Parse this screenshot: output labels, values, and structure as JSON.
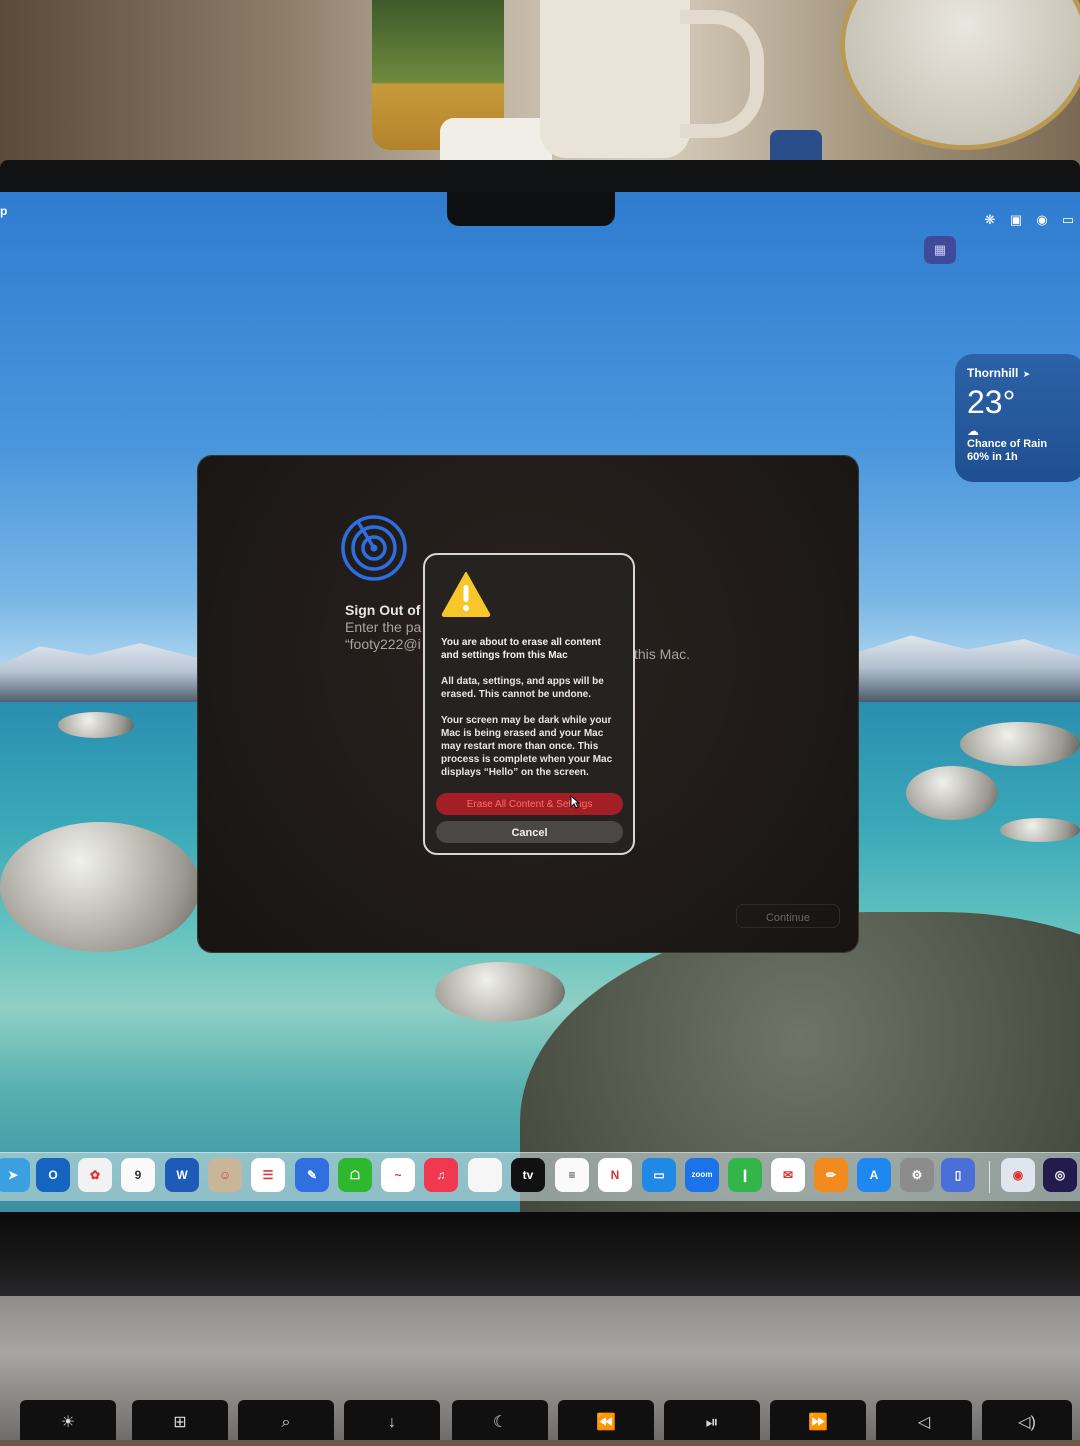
{
  "menubar": {
    "left_fragment": "p",
    "icons": [
      "chatgpt-icon",
      "screen-share-icon",
      "record-icon",
      "battery-icon"
    ]
  },
  "weather": {
    "city": "Thornhill",
    "location_glyph": "➤",
    "temperature": "23°",
    "condition_line1": "Chance of Rain",
    "condition_line2": "60% in 1h"
  },
  "assistant": {
    "title": "Sign Out of",
    "line1": "Enter the pa",
    "line2": "“footy222@i",
    "right_fragment": "this Mac.",
    "continue_label": "Continue"
  },
  "alert": {
    "title": "You are about to erase all content and settings from this Mac",
    "paragraph1": "All data, settings, and apps will be erased. This cannot be undone.",
    "paragraph2": "Your screen may be dark while your Mac is being erased and your Mac may restart more than once. This process is complete when your Mac displays “Hello” on the screen.",
    "erase_label": "Erase All Content & Settings",
    "cancel_label": "Cancel"
  },
  "dock": {
    "items": [
      {
        "name": "maps",
        "glyph": "➤",
        "color": "#3aa0e0"
      },
      {
        "name": "outlook",
        "glyph": "O",
        "color": "#1565c0"
      },
      {
        "name": "photos",
        "glyph": "✿",
        "color": "#f2f2f2"
      },
      {
        "name": "calendar",
        "glyph": "9",
        "color": "#fafafa"
      },
      {
        "name": "word",
        "glyph": "W",
        "color": "#1e5bb8"
      },
      {
        "name": "contacts",
        "glyph": "☺",
        "color": "#c8b69a"
      },
      {
        "name": "reminders",
        "glyph": "☰",
        "color": "#ffffff"
      },
      {
        "name": "feedback",
        "glyph": "✎",
        "color": "#2f6fe0"
      },
      {
        "name": "robinhood",
        "glyph": "☖",
        "color": "#2eb82e"
      },
      {
        "name": "freeform",
        "glyph": "~",
        "color": "#ffffff"
      },
      {
        "name": "music",
        "glyph": "♫",
        "color": "#f0394f"
      },
      {
        "name": "notes",
        "glyph": "",
        "color": "#f6f6f6"
      },
      {
        "name": "apple-tv",
        "glyph": "tv",
        "color": "#111111"
      },
      {
        "name": "pages",
        "glyph": "≡",
        "color": "#fafafa"
      },
      {
        "name": "news",
        "glyph": "N",
        "color": "#ffffff"
      },
      {
        "name": "keynote",
        "glyph": "▭",
        "color": "#1e8ae6"
      },
      {
        "name": "zoom",
        "glyph": "zoom",
        "color": "#1a73e8"
      },
      {
        "name": "numbers",
        "glyph": "❙",
        "color": "#33b54a"
      },
      {
        "name": "mail-pilot",
        "glyph": "✉",
        "color": "#ffffff"
      },
      {
        "name": "pages-orange",
        "glyph": "✏",
        "color": "#f28b1e"
      },
      {
        "name": "app-store",
        "glyph": "A",
        "color": "#1e88f0"
      },
      {
        "name": "system-settings",
        "glyph": "⚙",
        "color": "#8c8c8c"
      },
      {
        "name": "iphone-mirroring",
        "glyph": "▯",
        "color": "#4a6fd8"
      },
      {
        "name": "disk-utility",
        "glyph": "◉",
        "color": "#dfe6ee"
      },
      {
        "name": "siri",
        "glyph": "◎",
        "color": "#231a4e"
      }
    ]
  },
  "keyboard": {
    "keys": [
      "☀",
      "⊞",
      "⌕",
      "↓",
      "☾",
      "⏪",
      "⏯",
      "⏩",
      "◁",
      "◁)"
    ]
  }
}
